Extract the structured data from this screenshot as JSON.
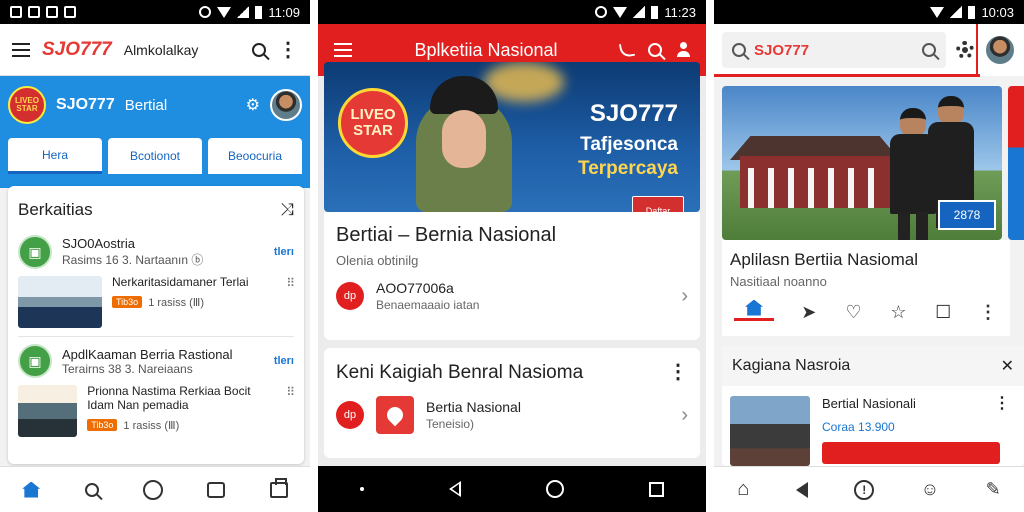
{
  "phone1": {
    "status": {
      "time": "11:09"
    },
    "appbar": {
      "brand": "SJO777",
      "subtitle": "Almkolalkay"
    },
    "hero": {
      "logo": "LIVEO STAR",
      "title": "SJO777",
      "title2": "Bertial"
    },
    "tabs": [
      "Hera",
      "Bcotionot",
      "Beoocuria"
    ],
    "list": {
      "title": "Berkaitias",
      "items": [
        {
          "name": "SJO0Aostria",
          "meta": "Rasims 16 3. Nartaanın ⓑ",
          "tag": "tlerı"
        },
        {
          "title": "Nerkaritasidamaner Terlai",
          "pill": "Tib3o",
          "meta": "1 rasiss (Ⅲ)"
        },
        {
          "name": "ApdlKaaman Berria Rastional",
          "meta": "Terairns 38 3. Nareiaans",
          "tag": "tlerı"
        },
        {
          "title": "Prionna Nastima Rerkiaa Bocit Idam Nan pemadia",
          "pill": "Tib3o",
          "meta": "1 rasiss (Ⅲ)"
        }
      ]
    },
    "bottom_nav": [
      "home-icon",
      "search-icon",
      "compass-icon",
      "chat-icon",
      "bag-icon"
    ]
  },
  "phone2": {
    "status": {
      "time": "11:23"
    },
    "appbar": {
      "title": "Bplketiia Nasional"
    },
    "banner": {
      "logo": "LIVEO STAR",
      "line1": "SJO777",
      "line2": "Tafjesonca",
      "line3": "Terpercaya",
      "button": "Daftar"
    },
    "card1": {
      "title": "Bertiai – Bernia Nasional",
      "subtitle": "Olenia obtinilg",
      "item_title": "AOO77006a",
      "item_sub": "Benaemaaaio iatan",
      "item_icon": "dp"
    },
    "card2": {
      "title": "Keni Kaigiah Benral Nasioma",
      "item_title": "Bertia Nasional",
      "item_sub": "Teneisio)",
      "item_icon": "dp"
    },
    "navbar": [
      "dot",
      "back",
      "home",
      "recents"
    ]
  },
  "phone3": {
    "status": {
      "time": "10:03"
    },
    "search": {
      "value": "SJO777"
    },
    "hero": {
      "badge": "2878"
    },
    "info": {
      "title": "Aplilasn Bertiia Nasiomal",
      "subtitle": "Nasitiaal noanno"
    },
    "section": {
      "title": "Kagiana Nasroia",
      "item_title": "Bertial Nasionali",
      "item_meta": "Coraa 13.900"
    },
    "bottom_nav": [
      "home-outline-icon",
      "back-icon",
      "alert-icon",
      "person-icon",
      "edit-icon"
    ]
  }
}
